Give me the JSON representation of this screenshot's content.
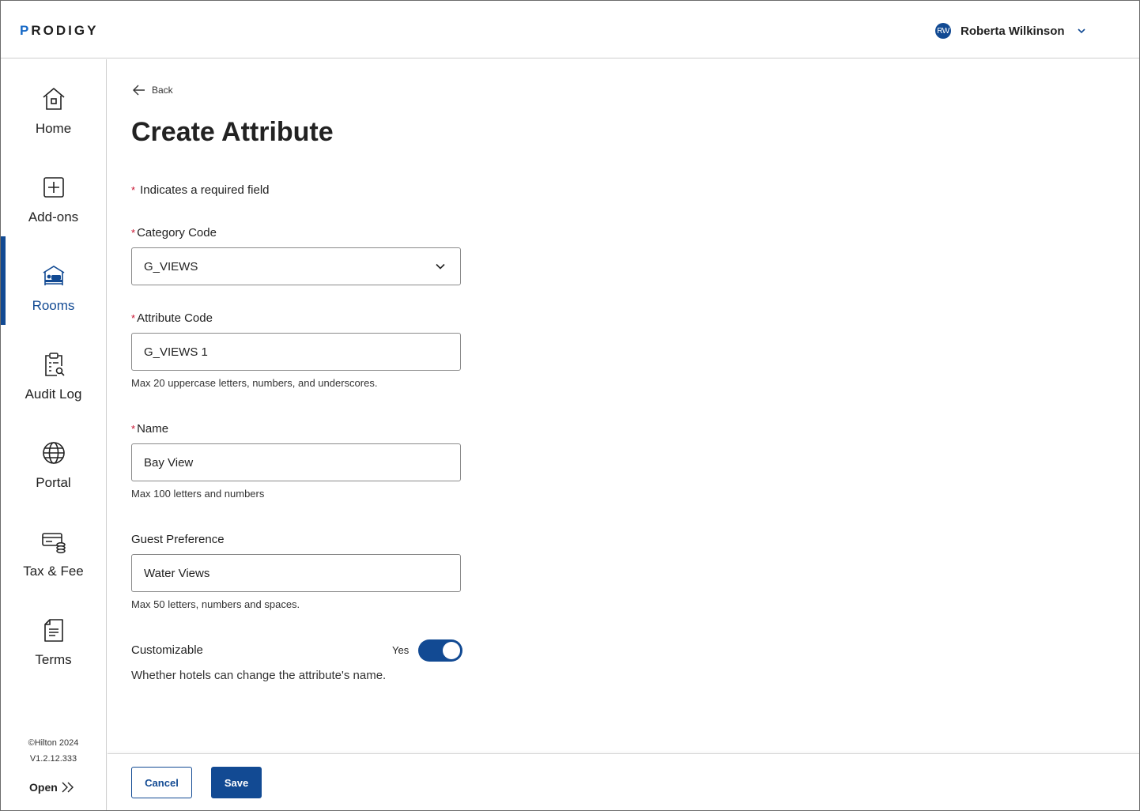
{
  "header": {
    "logo_text": "PRODIGY",
    "user": {
      "initials": "RW",
      "name": "Roberta Wilkinson"
    }
  },
  "sidebar": {
    "items": [
      {
        "label": "Home",
        "icon": "home-icon",
        "active": false
      },
      {
        "label": "Add-ons",
        "icon": "plus-square-icon",
        "active": false
      },
      {
        "label": "Rooms",
        "icon": "bed-icon",
        "active": true
      },
      {
        "label": "Audit Log",
        "icon": "clipboard-search-icon",
        "active": false
      },
      {
        "label": "Portal",
        "icon": "globe-icon",
        "active": false
      },
      {
        "label": "Tax & Fee",
        "icon": "card-coins-icon",
        "active": false
      },
      {
        "label": "Terms",
        "icon": "document-icon",
        "active": false
      }
    ],
    "copyright": "©Hilton 2024",
    "version": "V1.2.12.333",
    "open_label": "Open"
  },
  "page": {
    "back_label": "Back",
    "title": "Create Attribute",
    "required_note": "Indicates a required field"
  },
  "form": {
    "category_code": {
      "label": "Category Code",
      "required": true,
      "value": "G_VIEWS"
    },
    "attribute_code": {
      "label": "Attribute Code",
      "required": true,
      "value": "G_VIEWS 1",
      "help": "Max 20 uppercase letters, numbers, and underscores."
    },
    "name": {
      "label": "Name",
      "required": true,
      "value": "Bay View",
      "help": "Max 100 letters and numbers"
    },
    "guest_preference": {
      "label": "Guest Preference",
      "required": false,
      "value": "Water Views",
      "help": "Max 50 letters, numbers and spaces."
    },
    "customizable": {
      "label": "Customizable",
      "state_label": "Yes",
      "enabled": true,
      "help": "Whether hotels can change the attribute's name."
    }
  },
  "actions": {
    "cancel_label": "Cancel",
    "save_label": "Save"
  },
  "colors": {
    "primary": "#124a93",
    "required": "#c8102e",
    "logo_accent": "#1769c6"
  }
}
